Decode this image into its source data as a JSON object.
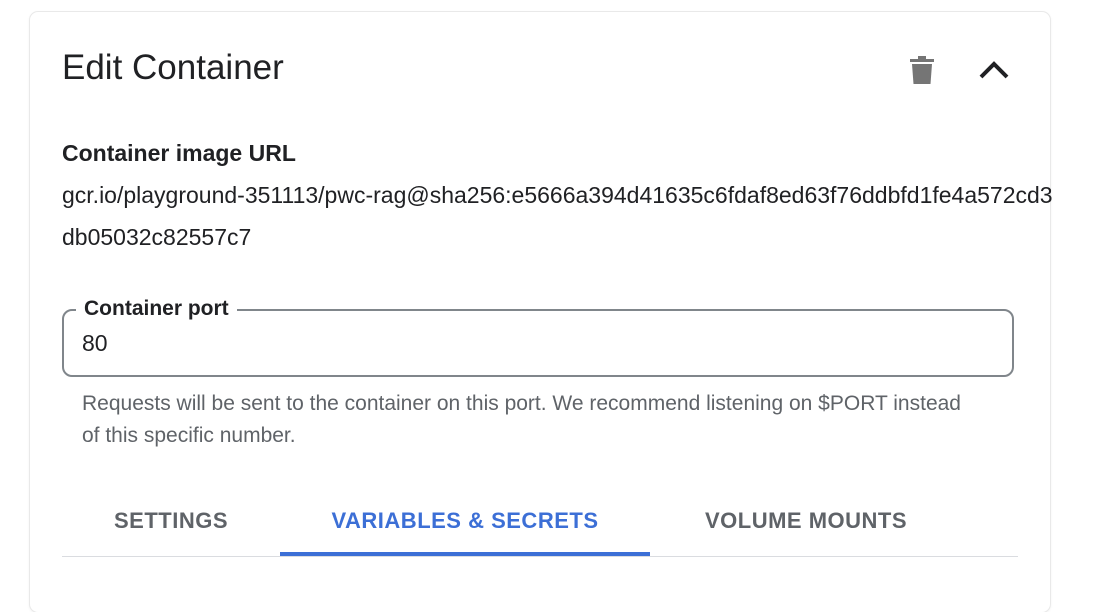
{
  "header": {
    "title": "Edit Container",
    "delete_icon": "trash-icon",
    "collapse_icon": "chevron-up-icon"
  },
  "image": {
    "label": "Container image URL",
    "url": "gcr.io/playground-351113/pwc-rag@sha256:e5666a394d41635c6fdaf8ed63f76ddbfd1fe4a572cd3db05032c82557c7"
  },
  "port": {
    "label": "Container port",
    "value": "80",
    "hint": "Requests will be sent to the container on this port. We recommend listening on $PORT instead of this specific number."
  },
  "tabs": [
    {
      "label": "SETTINGS",
      "active": false
    },
    {
      "label": "VARIABLES & SECRETS",
      "active": true
    },
    {
      "label": "VOLUME MOUNTS",
      "active": false
    }
  ],
  "colors": {
    "accent": "#3c6fd6",
    "text": "#202124",
    "muted": "#5f6368",
    "icon": "#757575",
    "border": "#80868b"
  }
}
